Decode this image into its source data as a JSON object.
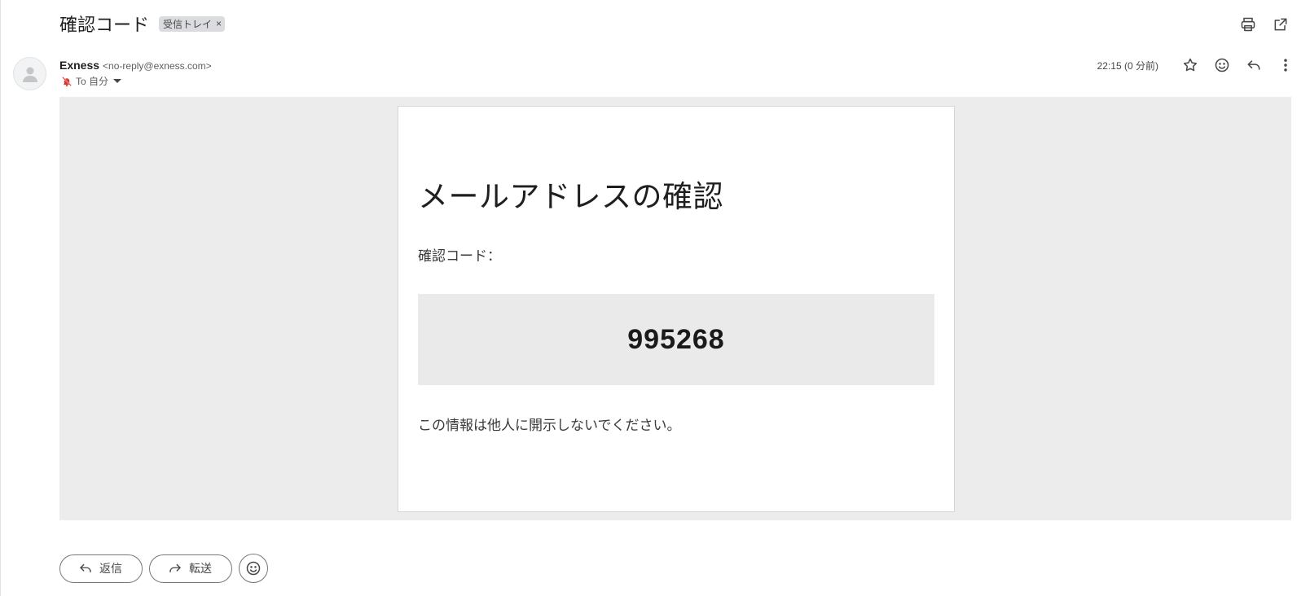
{
  "header": {
    "subject": "確認コード",
    "label_chip": "受信トレイ",
    "label_chip_remove": "×",
    "actions": [
      {
        "name": "print-icon"
      },
      {
        "name": "open-in-new-window-icon"
      }
    ]
  },
  "message": {
    "sender_name": "Exness",
    "sender_email": "<no-reply@exness.com>",
    "recipient": "To 自分",
    "timestamp": "22:15 (0 分前)",
    "meta_actions": [
      "star-icon",
      "emoji-icon",
      "reply-icon",
      "more-vert-icon"
    ]
  },
  "email_content": {
    "title": "メールアドレスの確認",
    "code_label": "確認コード：",
    "code": "995268",
    "notice": "この情報は他人に開示しないでください。"
  },
  "reply_bar": {
    "reply_label": "返信",
    "forward_label": "転送"
  },
  "colors": {
    "body_background": "#ececec",
    "code_box": "#eaeaea",
    "warning_red": "#d93025"
  }
}
